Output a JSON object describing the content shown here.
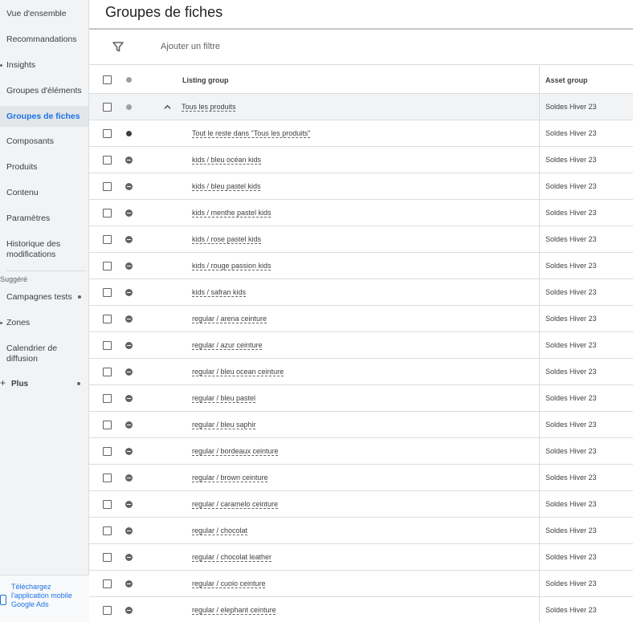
{
  "sidebar": {
    "items": [
      {
        "label": "Vue d'ensemble"
      },
      {
        "label": "Recommandations"
      },
      {
        "label": "Insights"
      },
      {
        "label": "Groupes d'éléments"
      },
      {
        "label": "Groupes de fiches"
      },
      {
        "label": "Composants"
      },
      {
        "label": "Produits"
      },
      {
        "label": "Contenu"
      },
      {
        "label": "Paramètres"
      },
      {
        "label": "Historique des modifications"
      }
    ],
    "suggested_label": "Suggéré",
    "suggested_items": [
      {
        "label": "Campagnes tests"
      },
      {
        "label": "Zones"
      },
      {
        "label": "Calendrier de diffusion"
      }
    ],
    "plus_label": "Plus",
    "download_text": "Téléchargez l'application mobile Google Ads"
  },
  "header": {
    "title": "Groupes de fiches"
  },
  "filter": {
    "label": "Ajouter un filtre"
  },
  "table": {
    "columns": {
      "listing_group": "Listing group",
      "asset_group": "Asset group"
    },
    "rows": [
      {
        "name": "Tous les produits",
        "asset": "Soldes Hiver 23",
        "status": "grey",
        "parent": true
      },
      {
        "name": "Tout le reste dans \"Tous les produits\"",
        "asset": "Soldes Hiver 23",
        "status": "dark"
      },
      {
        "name": "kids / bleu océan kids",
        "asset": "Soldes Hiver 23",
        "status": "excluded"
      },
      {
        "name": "kids / bleu pastel kids",
        "asset": "Soldes Hiver 23",
        "status": "excluded"
      },
      {
        "name": "kids / menthe pastel kids",
        "asset": "Soldes Hiver 23",
        "status": "excluded"
      },
      {
        "name": "kids / rose pastel kids",
        "asset": "Soldes Hiver 23",
        "status": "excluded"
      },
      {
        "name": "kids / rouge passion kids",
        "asset": "Soldes Hiver 23",
        "status": "excluded"
      },
      {
        "name": "kids / safran kids",
        "asset": "Soldes Hiver 23",
        "status": "excluded"
      },
      {
        "name": "regular / arena ceinture",
        "asset": "Soldes Hiver 23",
        "status": "excluded"
      },
      {
        "name": "regular / azur ceinture",
        "asset": "Soldes Hiver 23",
        "status": "excluded"
      },
      {
        "name": "regular / bleu ocean ceinture",
        "asset": "Soldes Hiver 23",
        "status": "excluded"
      },
      {
        "name": "regular / bleu pastel",
        "asset": "Soldes Hiver 23",
        "status": "excluded"
      },
      {
        "name": "regular / bleu saphir",
        "asset": "Soldes Hiver 23",
        "status": "excluded"
      },
      {
        "name": "regular / bordeaux ceinture",
        "asset": "Soldes Hiver 23",
        "status": "excluded"
      },
      {
        "name": "regular / brown ceinture",
        "asset": "Soldes Hiver 23",
        "status": "excluded"
      },
      {
        "name": "regular / caramelo ceinture",
        "asset": "Soldes Hiver 23",
        "status": "excluded"
      },
      {
        "name": "regular / chocolat",
        "asset": "Soldes Hiver 23",
        "status": "excluded"
      },
      {
        "name": "regular / chocolat leather",
        "asset": "Soldes Hiver 23",
        "status": "excluded"
      },
      {
        "name": "regular / cuoio ceinture",
        "asset": "Soldes Hiver 23",
        "status": "excluded"
      },
      {
        "name": "regular / elephant ceinture",
        "asset": "Soldes Hiver 23",
        "status": "excluded"
      }
    ]
  },
  "icons": {
    "filter": "filter-icon",
    "collapse": "chevron-up-icon",
    "status_excluded": "minus-circle-icon",
    "mobile": "mobile-phone-icon"
  },
  "colors": {
    "active_nav": "#1a73e8",
    "status_grey": "#9aa0a6",
    "status_dark": "#3c4043"
  }
}
